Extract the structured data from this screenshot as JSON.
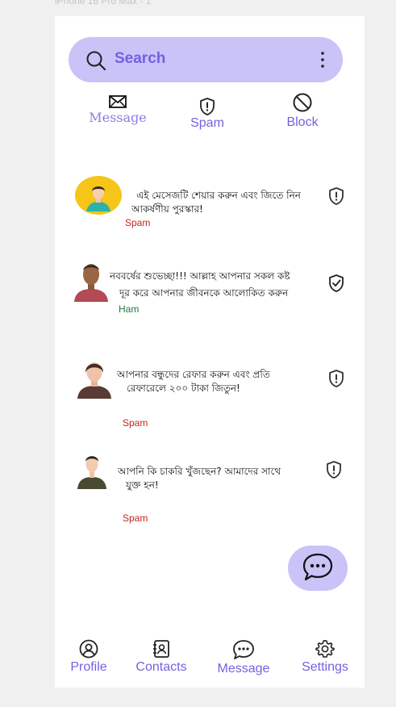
{
  "frame_label": "iPhone 16 Pro Max - 1",
  "search": {
    "placeholder": "Search"
  },
  "filters": [
    {
      "label": "Message",
      "icon": "envelope-icon"
    },
    {
      "label": "Spam",
      "icon": "shield-alert-icon"
    },
    {
      "label": "Block",
      "icon": "block-icon"
    }
  ],
  "messages": [
    {
      "text_line1": "এই মেসেজটি শেয়ার করুন এবং জিতে নিন",
      "text_line2": "আকর্ষণীয় পুরস্কার!",
      "tag": "Spam",
      "status_icon": "shield-alert-icon"
    },
    {
      "text_line1": "নববর্ষের শুভেচ্ছা!!! আল্লাহ আপনার সকল  কষ্ট",
      "text_line2": "দূর করে আপনার জীবনকে আলোকিত করুন",
      "tag": "Ham",
      "status_icon": "shield-check-icon"
    },
    {
      "text_line1": "আপনার বন্ধুদের রেফার করুন এবং প্রতি",
      "text_line2": "রেফারেলে ২০০ টাকা জিতুন!",
      "tag": "Spam",
      "status_icon": "shield-alert-icon"
    },
    {
      "text_line1": "আপনি কি চাকরি খুঁজছেন? আমাদের সাথে",
      "text_line2": "যুক্ত হন!",
      "tag": "Spam",
      "status_icon": "shield-alert-icon"
    }
  ],
  "nav": [
    {
      "label": "Profile",
      "icon": "profile-icon"
    },
    {
      "label": "Contacts",
      "icon": "contacts-icon"
    },
    {
      "label": "Message",
      "icon": "chat-icon"
    },
    {
      "label": "Settings",
      "icon": "gear-icon"
    }
  ],
  "colors": {
    "accent": "#7462e0",
    "search_bg": "#c9c3f7",
    "spam": "#c0261e",
    "ham": "#1f7a3f"
  }
}
